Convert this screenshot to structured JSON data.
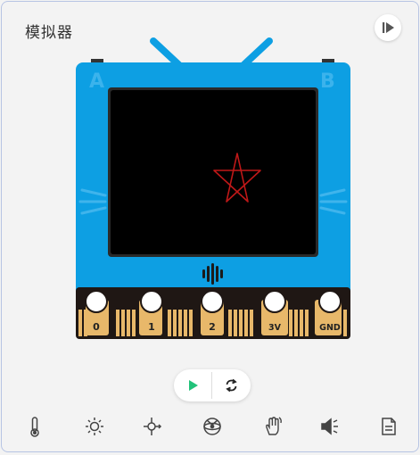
{
  "header": {
    "title": "模拟器"
  },
  "device": {
    "button_a_label": "A",
    "button_b_label": "B",
    "pins": [
      "0",
      "1",
      "2",
      "3V",
      "GND"
    ],
    "body_color": "#0d9fe3",
    "screen_color": "#000000",
    "edge_color": "#e8b86a",
    "screen_content": "red-pentagram"
  },
  "controls": {
    "run_icon": "play-icon",
    "reset_icon": "refresh-icon"
  },
  "tools": [
    "thermometer-icon",
    "light-icon",
    "compass-icon",
    "accelerometer-icon",
    "gesture-icon",
    "sound-icon",
    "file-icon"
  ]
}
